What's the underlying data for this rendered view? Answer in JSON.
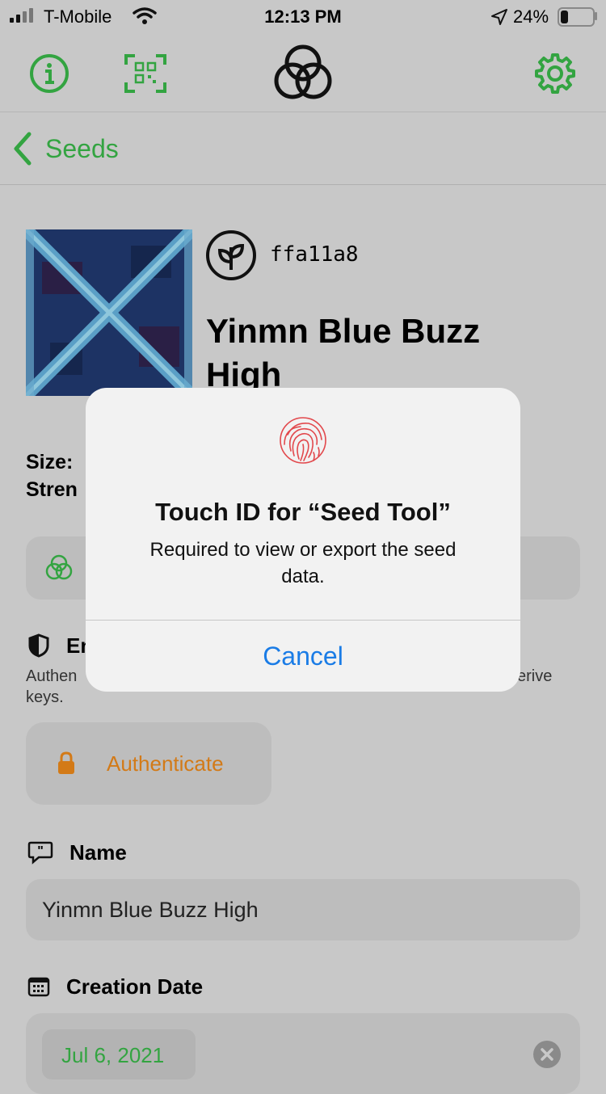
{
  "status_bar": {
    "carrier": "T-Mobile",
    "time": "12:13 PM",
    "battery": "24%",
    "battery_level": 0.24
  },
  "toolbar": {
    "info_icon": "info-circle-icon",
    "scan_icon": "qr-scan-icon",
    "logo_icon": "seed-tool-logo-icon",
    "settings_icon": "gear-icon"
  },
  "nav": {
    "back_label": "Seeds"
  },
  "seed": {
    "fingerprint": "ffa11a8",
    "name_line1": "Yinmn Blue Buzz",
    "name_line2": "High"
  },
  "details": {
    "size_label": "Size:",
    "strength_label": "Stren",
    "encrypted_heading": "En",
    "encrypted_desc_start": "Authen",
    "encrypted_desc_end": "erive",
    "encrypted_desc_line2": "keys.",
    "authenticate_label": "Authenticate"
  },
  "name_section": {
    "heading": "Name",
    "value": "Yinmn Blue Buzz High"
  },
  "date_section": {
    "heading": "Creation Date",
    "value": "Jul 6, 2021"
  },
  "dialog": {
    "title": "Touch ID for “Seed Tool”",
    "message": "Required to view or export the seed data.",
    "cancel": "Cancel"
  },
  "colors": {
    "accent_green": "#33a441",
    "authenticate_orange": "#d37a17",
    "cancel_blue": "#1a7ce6"
  }
}
